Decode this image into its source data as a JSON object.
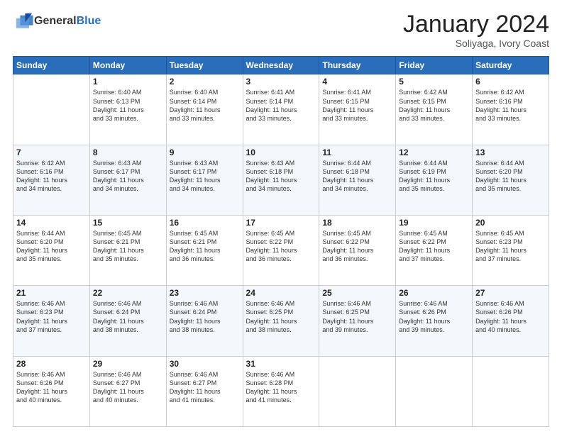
{
  "logo": {
    "general": "General",
    "blue": "Blue"
  },
  "title": "January 2024",
  "subtitle": "Soliyaga, Ivory Coast",
  "days_header": [
    "Sunday",
    "Monday",
    "Tuesday",
    "Wednesday",
    "Thursday",
    "Friday",
    "Saturday"
  ],
  "weeks": [
    [
      {
        "num": "",
        "info": ""
      },
      {
        "num": "1",
        "info": "Sunrise: 6:40 AM\nSunset: 6:13 PM\nDaylight: 11 hours\nand 33 minutes."
      },
      {
        "num": "2",
        "info": "Sunrise: 6:40 AM\nSunset: 6:14 PM\nDaylight: 11 hours\nand 33 minutes."
      },
      {
        "num": "3",
        "info": "Sunrise: 6:41 AM\nSunset: 6:14 PM\nDaylight: 11 hours\nand 33 minutes."
      },
      {
        "num": "4",
        "info": "Sunrise: 6:41 AM\nSunset: 6:15 PM\nDaylight: 11 hours\nand 33 minutes."
      },
      {
        "num": "5",
        "info": "Sunrise: 6:42 AM\nSunset: 6:15 PM\nDaylight: 11 hours\nand 33 minutes."
      },
      {
        "num": "6",
        "info": "Sunrise: 6:42 AM\nSunset: 6:16 PM\nDaylight: 11 hours\nand 33 minutes."
      }
    ],
    [
      {
        "num": "7",
        "info": "Sunrise: 6:42 AM\nSunset: 6:16 PM\nDaylight: 11 hours\nand 34 minutes."
      },
      {
        "num": "8",
        "info": "Sunrise: 6:43 AM\nSunset: 6:17 PM\nDaylight: 11 hours\nand 34 minutes."
      },
      {
        "num": "9",
        "info": "Sunrise: 6:43 AM\nSunset: 6:17 PM\nDaylight: 11 hours\nand 34 minutes."
      },
      {
        "num": "10",
        "info": "Sunrise: 6:43 AM\nSunset: 6:18 PM\nDaylight: 11 hours\nand 34 minutes."
      },
      {
        "num": "11",
        "info": "Sunrise: 6:44 AM\nSunset: 6:18 PM\nDaylight: 11 hours\nand 34 minutes."
      },
      {
        "num": "12",
        "info": "Sunrise: 6:44 AM\nSunset: 6:19 PM\nDaylight: 11 hours\nand 35 minutes."
      },
      {
        "num": "13",
        "info": "Sunrise: 6:44 AM\nSunset: 6:20 PM\nDaylight: 11 hours\nand 35 minutes."
      }
    ],
    [
      {
        "num": "14",
        "info": "Sunrise: 6:44 AM\nSunset: 6:20 PM\nDaylight: 11 hours\nand 35 minutes."
      },
      {
        "num": "15",
        "info": "Sunrise: 6:45 AM\nSunset: 6:21 PM\nDaylight: 11 hours\nand 35 minutes."
      },
      {
        "num": "16",
        "info": "Sunrise: 6:45 AM\nSunset: 6:21 PM\nDaylight: 11 hours\nand 36 minutes."
      },
      {
        "num": "17",
        "info": "Sunrise: 6:45 AM\nSunset: 6:22 PM\nDaylight: 11 hours\nand 36 minutes."
      },
      {
        "num": "18",
        "info": "Sunrise: 6:45 AM\nSunset: 6:22 PM\nDaylight: 11 hours\nand 36 minutes."
      },
      {
        "num": "19",
        "info": "Sunrise: 6:45 AM\nSunset: 6:22 PM\nDaylight: 11 hours\nand 37 minutes."
      },
      {
        "num": "20",
        "info": "Sunrise: 6:45 AM\nSunset: 6:23 PM\nDaylight: 11 hours\nand 37 minutes."
      }
    ],
    [
      {
        "num": "21",
        "info": "Sunrise: 6:46 AM\nSunset: 6:23 PM\nDaylight: 11 hours\nand 37 minutes."
      },
      {
        "num": "22",
        "info": "Sunrise: 6:46 AM\nSunset: 6:24 PM\nDaylight: 11 hours\nand 38 minutes."
      },
      {
        "num": "23",
        "info": "Sunrise: 6:46 AM\nSunset: 6:24 PM\nDaylight: 11 hours\nand 38 minutes."
      },
      {
        "num": "24",
        "info": "Sunrise: 6:46 AM\nSunset: 6:25 PM\nDaylight: 11 hours\nand 38 minutes."
      },
      {
        "num": "25",
        "info": "Sunrise: 6:46 AM\nSunset: 6:25 PM\nDaylight: 11 hours\nand 39 minutes."
      },
      {
        "num": "26",
        "info": "Sunrise: 6:46 AM\nSunset: 6:26 PM\nDaylight: 11 hours\nand 39 minutes."
      },
      {
        "num": "27",
        "info": "Sunrise: 6:46 AM\nSunset: 6:26 PM\nDaylight: 11 hours\nand 40 minutes."
      }
    ],
    [
      {
        "num": "28",
        "info": "Sunrise: 6:46 AM\nSunset: 6:26 PM\nDaylight: 11 hours\nand 40 minutes."
      },
      {
        "num": "29",
        "info": "Sunrise: 6:46 AM\nSunset: 6:27 PM\nDaylight: 11 hours\nand 40 minutes."
      },
      {
        "num": "30",
        "info": "Sunrise: 6:46 AM\nSunset: 6:27 PM\nDaylight: 11 hours\nand 41 minutes."
      },
      {
        "num": "31",
        "info": "Sunrise: 6:46 AM\nSunset: 6:28 PM\nDaylight: 11 hours\nand 41 minutes."
      },
      {
        "num": "",
        "info": ""
      },
      {
        "num": "",
        "info": ""
      },
      {
        "num": "",
        "info": ""
      }
    ]
  ]
}
